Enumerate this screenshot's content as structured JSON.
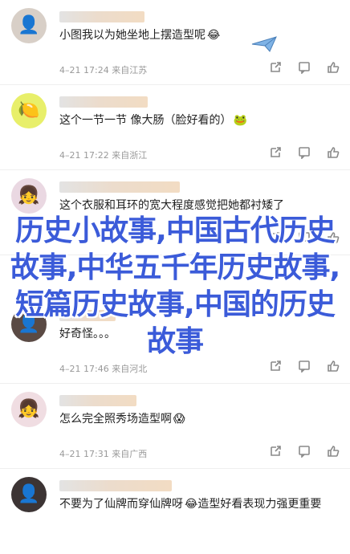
{
  "comments": [
    {
      "text": "小图我以为她坐地上摆造型呢",
      "emoji": "😂",
      "meta": "4–21 17:24 来自江苏",
      "avatar_icon": "person-avatar-icon",
      "avatar_bg": "#d8cfc7"
    },
    {
      "text": "这个一节一节 像大肠（脸好看的）",
      "emoji": "🐸",
      "meta": "4–21 17:22 来自浙江",
      "avatar_icon": "lemon-avatar-icon",
      "avatar_bg": "#e8ef6a"
    },
    {
      "text": "这个衣服和耳环的宽大程度感觉把她都衬矮了",
      "emoji": "",
      "meta": "4–21 17:46 来自河北",
      "avatar_icon": "anime-avatar-icon",
      "avatar_bg": "#ead8e2"
    },
    {
      "text": "好奇怪。。。",
      "emoji": "",
      "meta": "4–21 17:46 来自河北",
      "avatar_icon": "person-avatar-icon",
      "avatar_bg": "#5a4a44"
    },
    {
      "text": "怎么完全照秀场造型啊",
      "emoji": "😱",
      "meta": "4–21 17:31 来自广西",
      "avatar_icon": "anime-avatar-icon",
      "avatar_bg": "#f0dde2"
    },
    {
      "text": "不要为了仙牌而穿仙牌呀",
      "emoji": "😂",
      "text2": "造型好看表现力强更重要",
      "meta": "",
      "avatar_icon": "person-avatar-icon",
      "avatar_bg": "#3c3434"
    }
  ],
  "overlay_title": "历史小故事,中国古代历史故事,中华五千年历史故事,短篇历史故事,中国的历史故事",
  "accent_color": "#3b5bd9",
  "action_icons": [
    "share-icon",
    "comment-icon",
    "like-icon"
  ]
}
